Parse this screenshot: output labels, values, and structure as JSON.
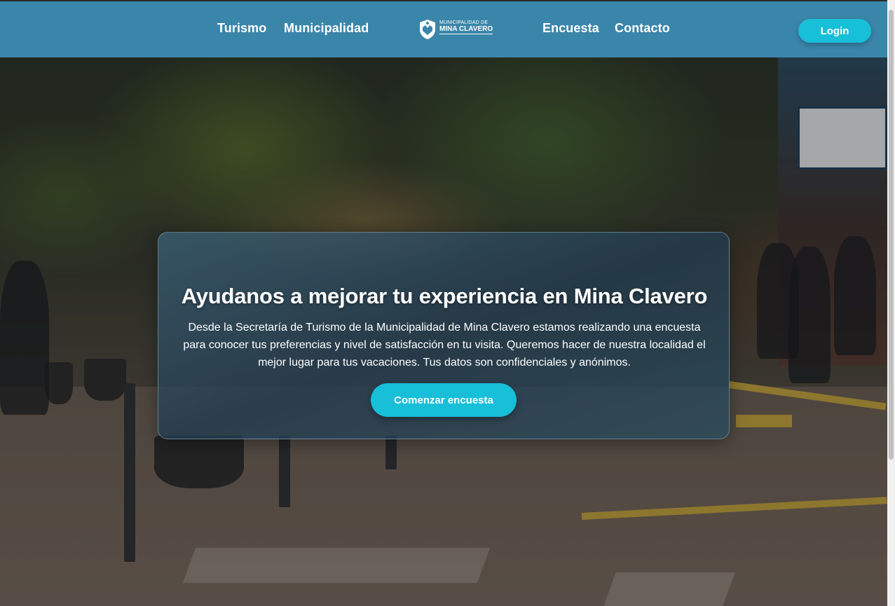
{
  "nav": {
    "left": [
      "Turismo",
      "Municipalidad"
    ],
    "right": [
      "Encuesta",
      "Contacto"
    ],
    "login_label": "Login"
  },
  "logo": {
    "line1": "MUNICIPALIDAD DE",
    "line2": "MINA CLAVERO"
  },
  "hero": {
    "title": "Ayudanos a mejorar tu experiencia en Mina Clavero",
    "description": "Desde la Secretaría de Turismo de la Municipalidad de Mina Clavero estamos realizando una encuesta para conocer tus preferencias y nivel de satisfacción en tu visita. Queremos hacer de nuestra localidad el mejor lugar para tus vacaciones. Tus datos son confidenciales y anónimos.",
    "button_label": "Comenzar encuesta"
  },
  "colors": {
    "header_bg": "#3a86aa",
    "accent": "#17bfd8"
  }
}
